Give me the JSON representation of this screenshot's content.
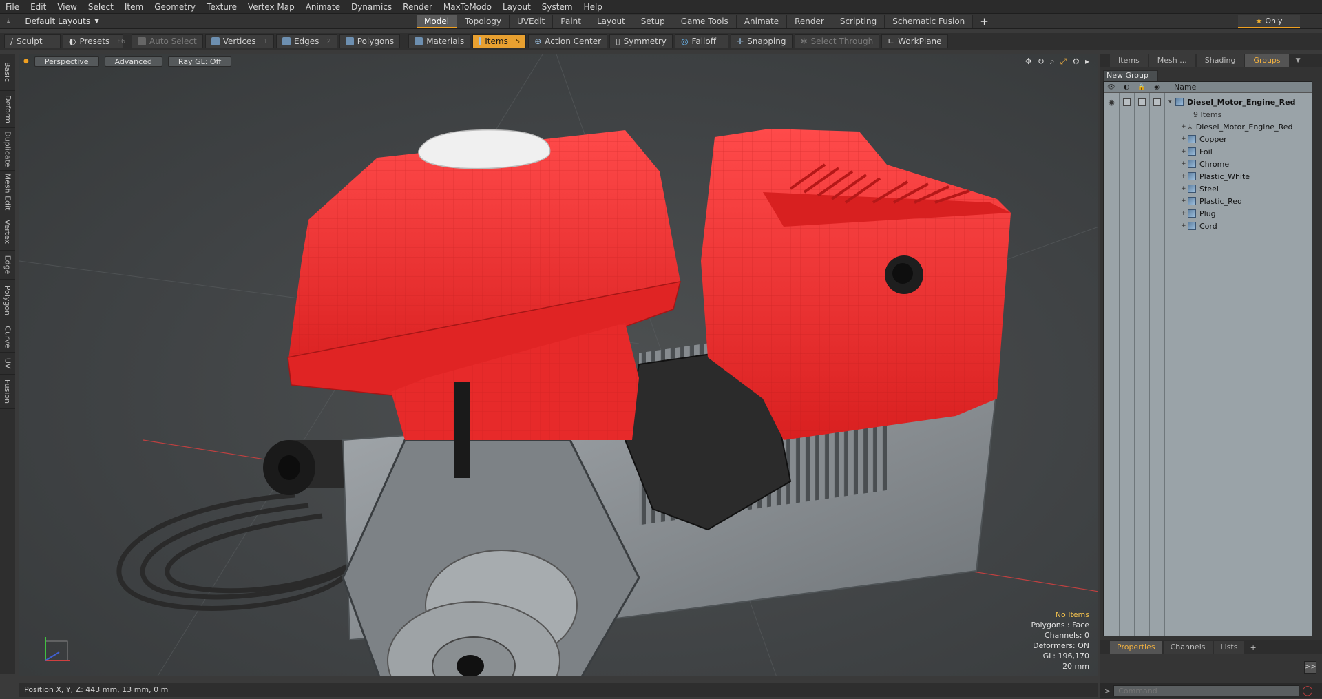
{
  "menu": [
    "File",
    "Edit",
    "View",
    "Select",
    "Item",
    "Geometry",
    "Texture",
    "Vertex Map",
    "Animate",
    "Dynamics",
    "Render",
    "MaxToModo",
    "Layout",
    "System",
    "Help"
  ],
  "layout_selector": "Default Layouts",
  "mode_tabs": [
    "Model",
    "Topology",
    "UVEdit",
    "Paint",
    "Layout",
    "Setup",
    "Game Tools",
    "Animate",
    "Render",
    "Scripting",
    "Schematic Fusion"
  ],
  "active_mode_tab": "Model",
  "only_label": "Only",
  "toolbar": {
    "sculpt": "Sculpt",
    "presets": "Presets",
    "presets_key": "F6",
    "auto_select": "Auto Select",
    "vertices": "Vertices",
    "vertices_key": "1",
    "edges": "Edges",
    "edges_key": "2",
    "polygons": "Polygons",
    "materials": "Materials",
    "items": "Items",
    "items_key": "5",
    "action_center": "Action Center",
    "symmetry": "Symmetry",
    "falloff": "Falloff",
    "snapping": "Snapping",
    "select_through": "Select Through",
    "workplane": "WorkPlane"
  },
  "left_tabs": [
    "Basic",
    "Deform",
    "Duplicate",
    "Mesh Edit",
    "Vertex",
    "Edge",
    "Polygon",
    "Curve",
    "UV",
    "Fusion"
  ],
  "viewport": {
    "view": "Perspective",
    "shading": "Advanced",
    "raygl": "Ray GL: Off",
    "info": {
      "selection": "No Items",
      "polygons": "Polygons : Face",
      "channels": "Channels: 0",
      "deformers": "Deformers: ON",
      "gl": "GL: 196,170",
      "scale": "20 mm"
    }
  },
  "status": "Position X, Y, Z:  443 mm, 13 mm, 0 m",
  "right_panel": {
    "tabs": [
      "Items",
      "Mesh ...",
      "Shading",
      "Groups"
    ],
    "active_tab": "Groups",
    "new_group": "New Group",
    "name_header": "Name",
    "group_name": "Diesel_Motor_Engine_Red",
    "group_count": "9 Items",
    "children": [
      "Diesel_Motor_Engine_Red",
      "Copper",
      "Foil",
      "Chrome",
      "Plastic_White",
      "Steel",
      "Plastic_Red",
      "Plug",
      "Cord"
    ],
    "bottom_tabs": [
      "Properties",
      "Channels",
      "Lists"
    ],
    "active_bottom_tab": "Properties",
    "command_placeholder": "Command"
  },
  "colors": {
    "accent": "#f0a020",
    "engine_red": "#ee3030",
    "metal": "#8f9498",
    "dark_plastic": "#262626"
  }
}
